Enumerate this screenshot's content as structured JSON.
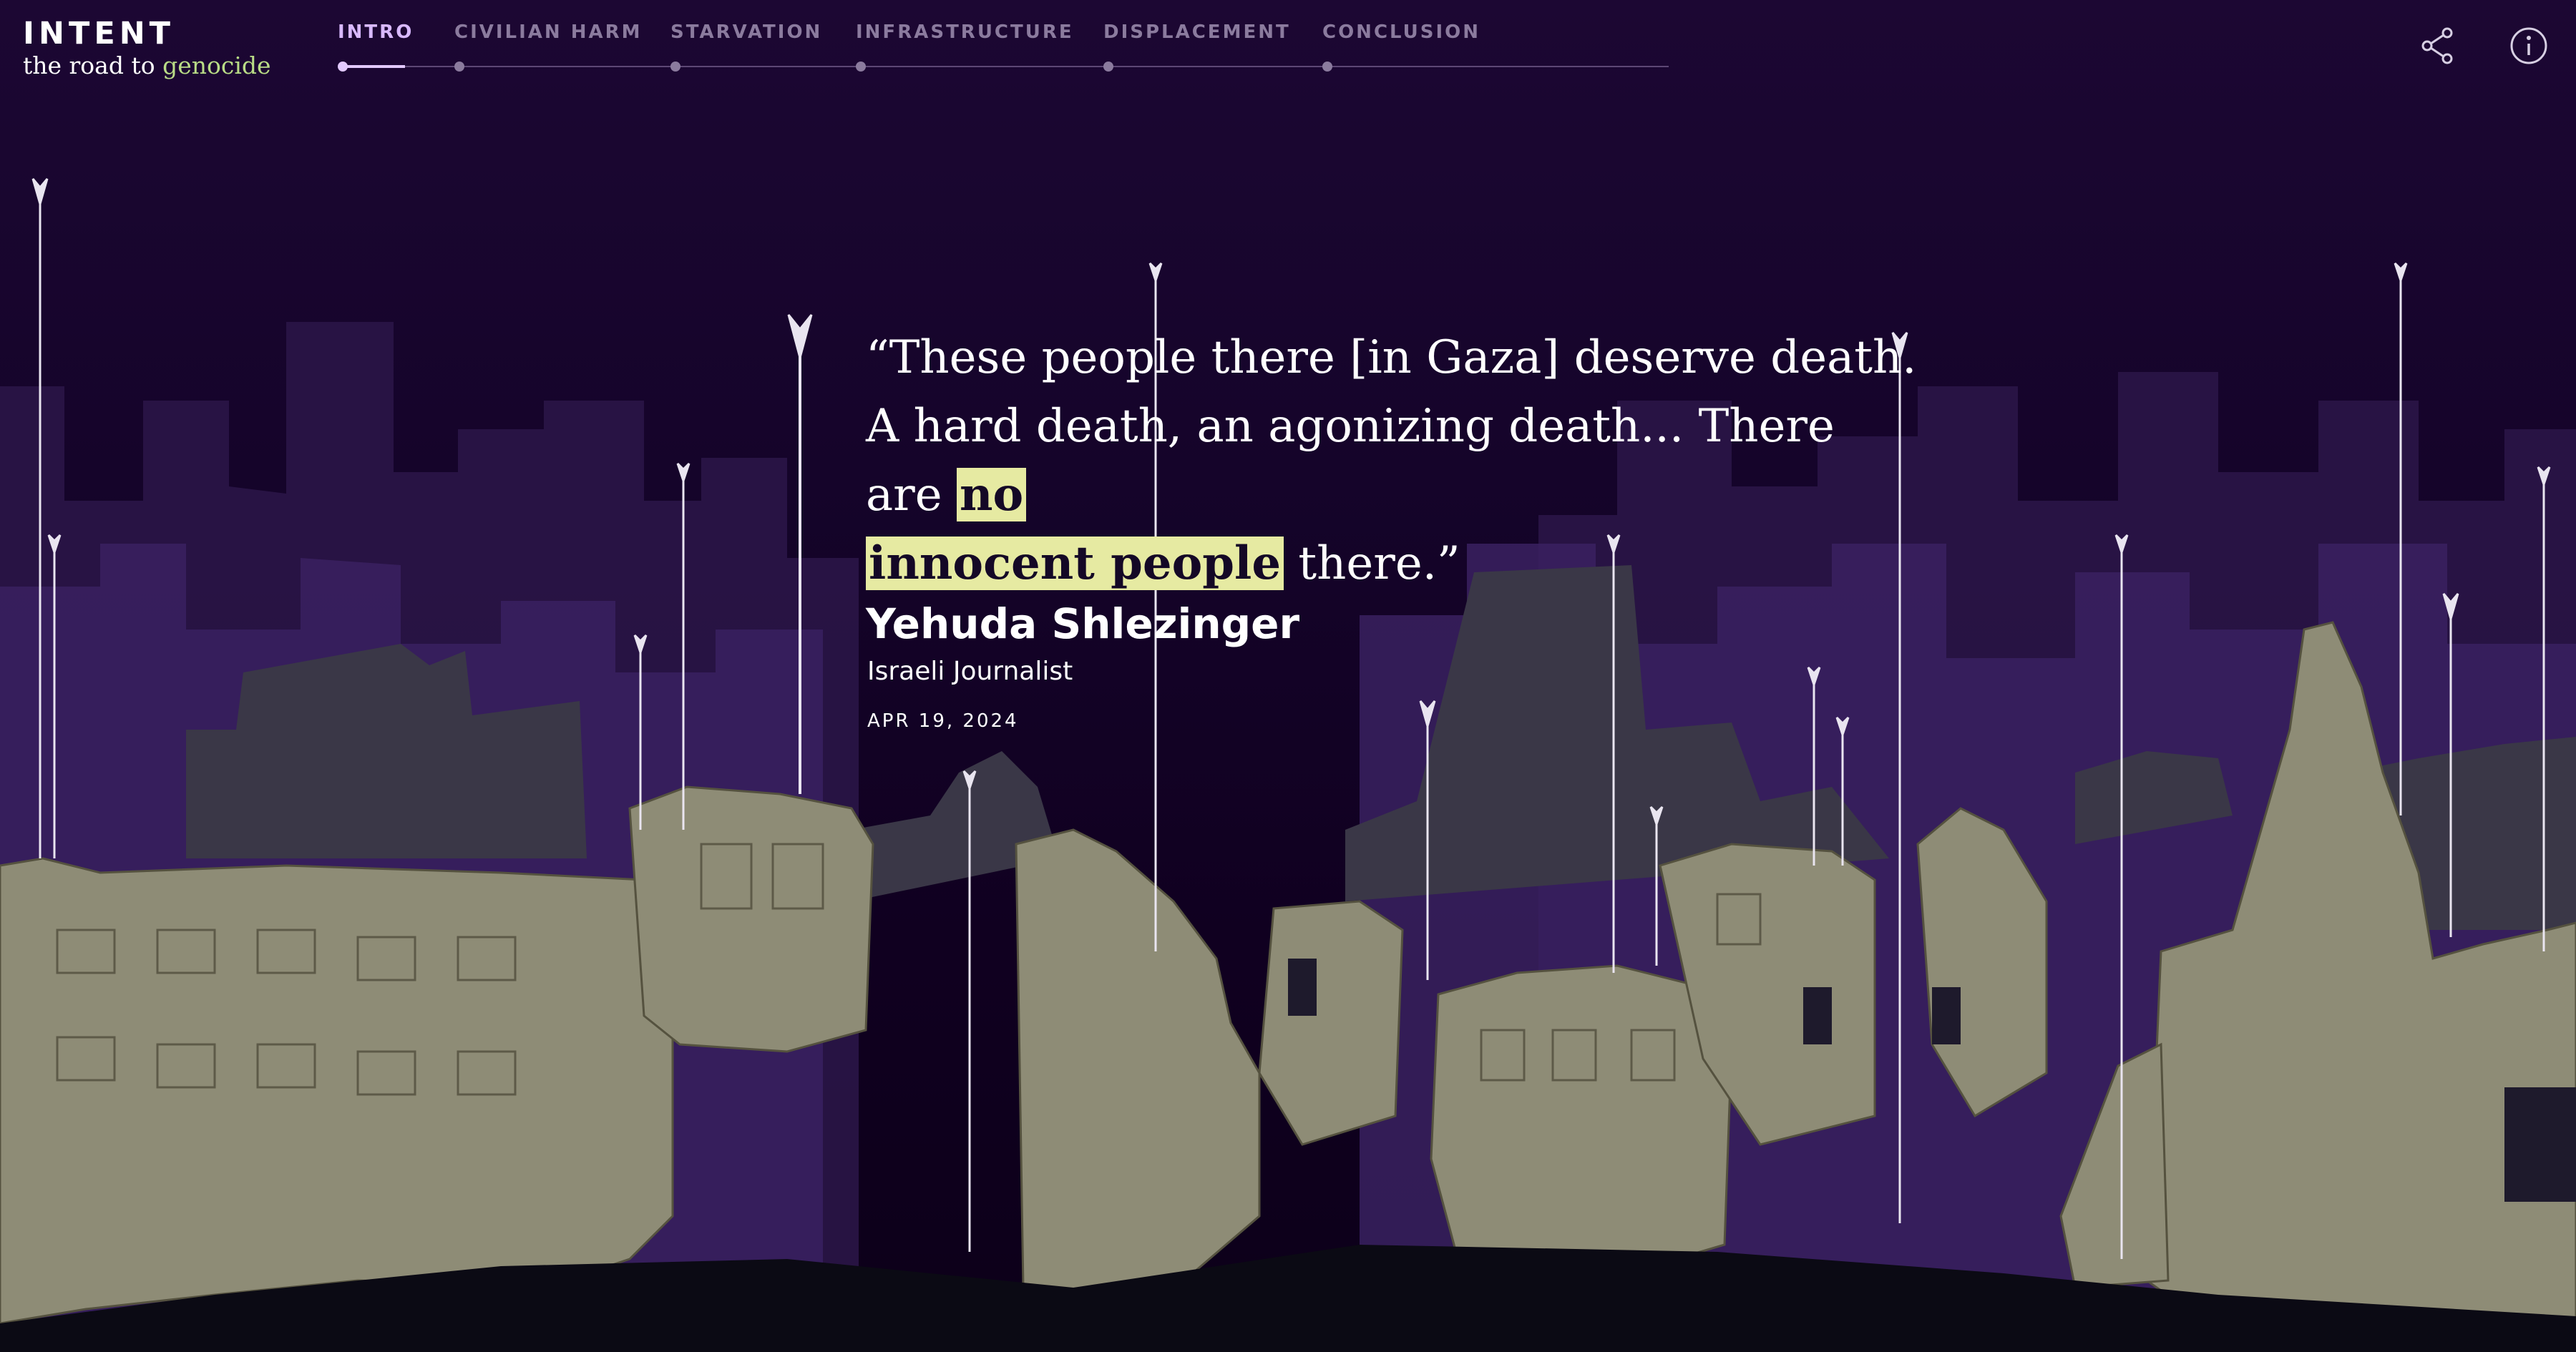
{
  "brand": {
    "title": "INTENT",
    "subtitle_prefix": "the road to ",
    "subtitle_accent": "genocide"
  },
  "nav": {
    "items": [
      {
        "label": "INTRO",
        "active": true
      },
      {
        "label": "CIVILIAN HARM",
        "active": false
      },
      {
        "label": "STARVATION",
        "active": false
      },
      {
        "label": "INFRASTRUCTURE",
        "active": false
      },
      {
        "label": "DISPLACEMENT",
        "active": false
      },
      {
        "label": "CONCLUSION",
        "active": false
      }
    ]
  },
  "header_icons": {
    "share": "share-icon",
    "info": "info-icon"
  },
  "quote": {
    "part1": "“These people there [in Gaza] deserve death. A hard death, an agonizing death... There are ",
    "highlight1": "no",
    "highlight2": "innocent people",
    "part2": " there.”",
    "author": "Yehuda Shlezinger",
    "role": "Israeli Journalist",
    "date": "APR 19, 2024"
  },
  "colors": {
    "background": "#120022",
    "accent_nav": "#d9b9ff",
    "highlight": "#e6eaa2",
    "brand_accent": "#b9dc86",
    "rubble": "#8e8c76"
  }
}
